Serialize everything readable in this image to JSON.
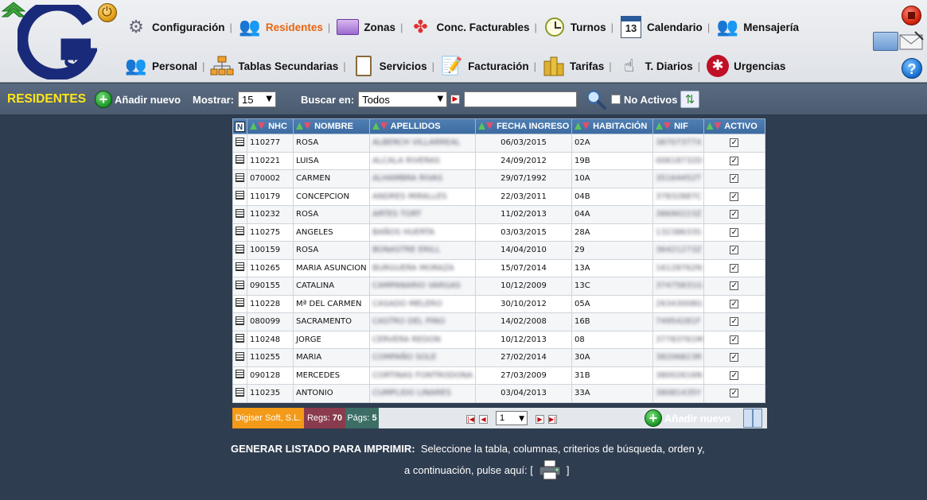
{
  "header": {
    "logo_text": "Gs",
    "nav_row1": [
      {
        "label": "Configuración",
        "icon": "gear-icon"
      },
      {
        "label": "Residentes",
        "icon": "residents-icon",
        "active": true
      },
      {
        "label": "Zonas",
        "icon": "zones-folder-icon"
      },
      {
        "label": "Conc. Facturables",
        "icon": "billable-concepts-icon"
      },
      {
        "label": "Turnos",
        "icon": "clock-icon"
      },
      {
        "label": "Calendario",
        "icon": "calendar-icon"
      },
      {
        "label": "Mensajería",
        "icon": "messaging-icon"
      }
    ],
    "nav_row2": [
      {
        "label": "Personal",
        "icon": "staff-icon"
      },
      {
        "label": "Tablas Secundarias",
        "icon": "tables-hierarchy-icon"
      },
      {
        "label": "Servicios",
        "icon": "clipboard-icon"
      },
      {
        "label": "Facturación",
        "icon": "invoice-pencil-icon"
      },
      {
        "label": "Tarifas",
        "icon": "coins-icon"
      },
      {
        "label": "T. Diarios",
        "icon": "hand-touch-icon"
      },
      {
        "label": "Urgencias",
        "icon": "medical-star-icon"
      }
    ],
    "help_label": "?"
  },
  "toolbar": {
    "title": "RESIDENTES",
    "add_label": "Añadir nuevo",
    "show_label": "Mostrar:",
    "show_value": "15",
    "search_label": "Buscar en:",
    "search_field_value": "Todos",
    "search_text": "",
    "no_active_label": "No Activos"
  },
  "table": {
    "n_label": "N",
    "columns": [
      "NHC",
      "NOMBRE",
      "APELLIDOS",
      "FECHA INGRESO",
      "HABITACIÓN",
      "NIF",
      "ACTIVO"
    ],
    "rows": [
      {
        "nhc": "110277",
        "nombre": "ROSA",
        "apellidos": "ALBERCH VILLARREAL",
        "fecha": "06/03/2015",
        "hab": "02A",
        "nif": "38707377X",
        "activo": true
      },
      {
        "nhc": "110221",
        "nombre": "LUISA",
        "apellidos": "ALCALA RIVERAS",
        "fecha": "24/09/2012",
        "hab": "19B",
        "nif": "00618732D",
        "activo": true
      },
      {
        "nhc": "070002",
        "nombre": "CARMEN",
        "apellidos": "ALHAMBRA RIVAS",
        "fecha": "29/07/1992",
        "hab": "10A",
        "nif": "35164452T",
        "activo": true
      },
      {
        "nhc": "110179",
        "nombre": "CONCEPCION",
        "apellidos": "ANDRES MIRALLES",
        "fecha": "22/03/2011",
        "hab": "04B",
        "nif": "37832887C",
        "activo": true
      },
      {
        "nhc": "110232",
        "nombre": "ROSA",
        "apellidos": "ARTES TORT",
        "fecha": "11/02/2013",
        "hab": "04A",
        "nif": "38690223Z",
        "activo": true
      },
      {
        "nhc": "110275",
        "nombre": "ANGELES",
        "apellidos": "BAÑOS HUERTA",
        "fecha": "03/03/2015",
        "hab": "28A",
        "nif": "13238633S",
        "activo": true
      },
      {
        "nhc": "100159",
        "nombre": "ROSA",
        "apellidos": "BONASTRE ERILL",
        "fecha": "14/04/2010",
        "hab": "29",
        "nif": "36421273Z",
        "activo": true
      },
      {
        "nhc": "110265",
        "nombre": "MARIA ASUNCION",
        "apellidos": "BURGUERA MORAZA",
        "fecha": "15/07/2014",
        "hab": "13A",
        "nif": "16128762N",
        "activo": true
      },
      {
        "nhc": "090155",
        "nombre": "CATALINA",
        "apellidos": "CAMPANARIO VARGAS",
        "fecha": "10/12/2009",
        "hab": "13C",
        "nif": "37475831G",
        "activo": true
      },
      {
        "nhc": "110228",
        "nombre": "Mª DEL CARMEN",
        "apellidos": "CASADO MELERO",
        "fecha": "30/10/2012",
        "hab": "05A",
        "nif": "26343008G",
        "activo": true
      },
      {
        "nhc": "080099",
        "nombre": "SACRAMENTO",
        "apellidos": "CASTRO DEL PINO",
        "fecha": "14/02/2008",
        "hab": "16B",
        "nif": "74954281F",
        "activo": true
      },
      {
        "nhc": "110248",
        "nombre": "JORGE",
        "apellidos": "CERVERA REDON",
        "fecha": "10/12/2013",
        "hab": "08",
        "nif": "37783761M",
        "activo": true
      },
      {
        "nhc": "110255",
        "nombre": "MARIA",
        "apellidos": "COMPAÑO SOLE",
        "fecha": "27/02/2014",
        "hab": "30A",
        "nif": "38206823R",
        "activo": true
      },
      {
        "nhc": "090128",
        "nombre": "MERCEDES",
        "apellidos": "CORTINAS FONTRODONA",
        "fecha": "27/03/2009",
        "hab": "31B",
        "nif": "38002616N",
        "activo": true
      },
      {
        "nhc": "110235",
        "nombre": "ANTONIO",
        "apellidos": "CUMPLIDO LINARES",
        "fecha": "03/04/2013",
        "hab": "33A",
        "nif": "38081435Y",
        "activo": true
      }
    ]
  },
  "footer": {
    "company": "Digiser Soft, S.L.",
    "regs_label": "Regs:",
    "regs_value": "70",
    "pags_label": "Págs:",
    "pags_value": "5",
    "current_page": "1",
    "add_label": "Añadir nuevo"
  },
  "print": {
    "title": "GENERAR LISTADO PARA IMPRIMIR:",
    "line1": "Seleccione la tabla, columnas, criterios de búsqueda, orden y,",
    "line2_prefix": "a continuación, pulse aquí: [",
    "line2_suffix": "]"
  },
  "colors": {
    "accent_yellow": "#ffe619",
    "active_orange": "#e8650d",
    "header_blue": "#3c6aa0",
    "background": "#2f3d50"
  }
}
